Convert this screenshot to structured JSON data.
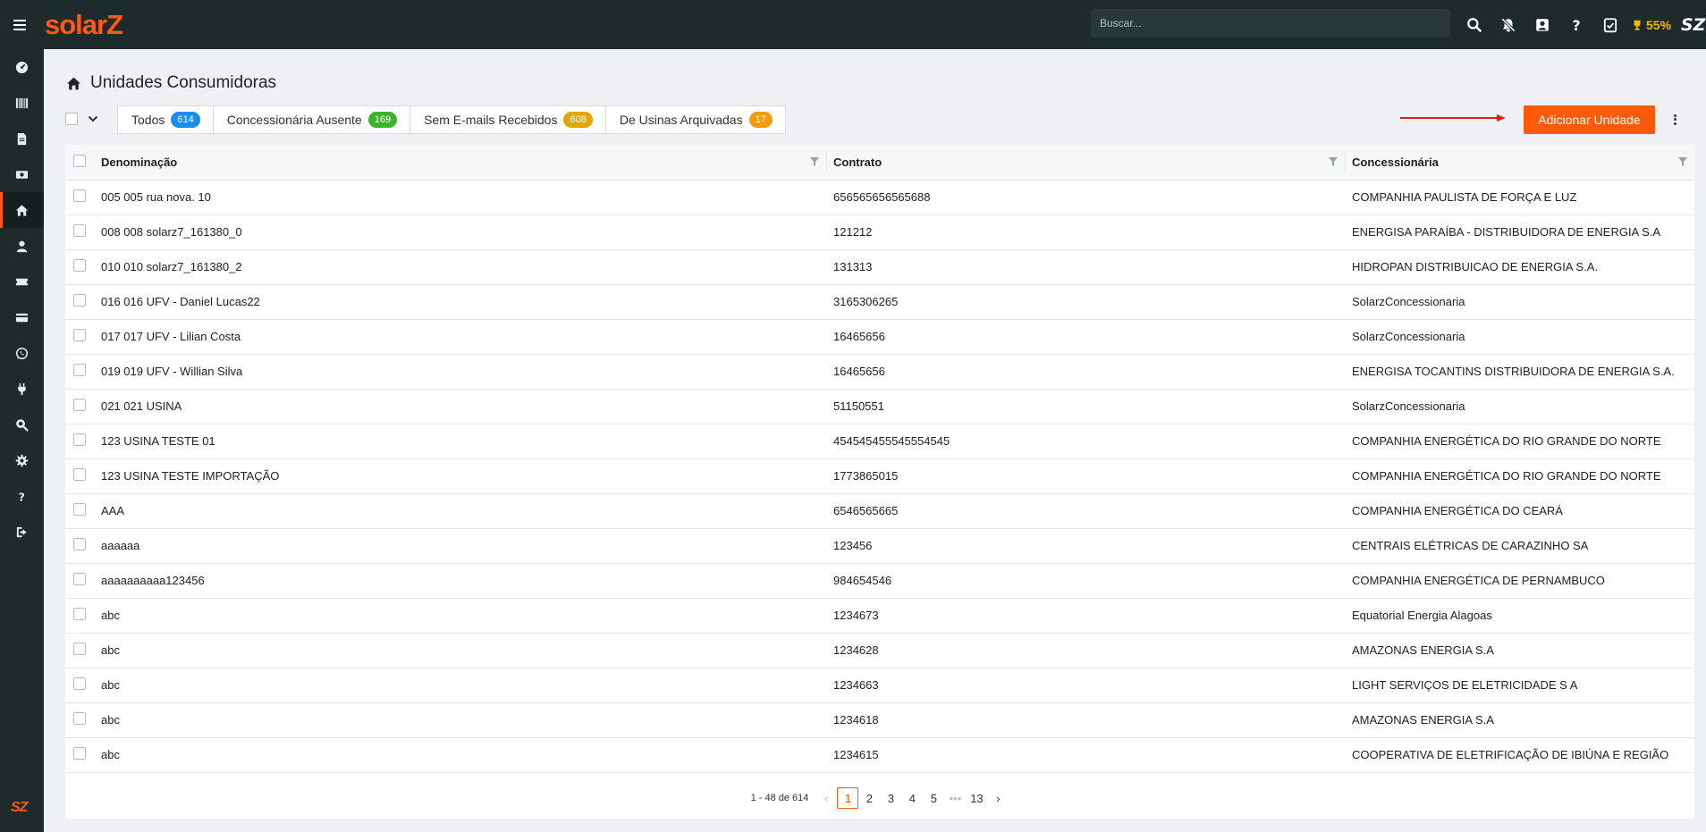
{
  "app": {
    "brand": "solarZ",
    "brand_color": "#ff5a12"
  },
  "topbar": {
    "search_placeholder": "Buscar...",
    "icons": [
      "search-icon",
      "notifications-off-icon",
      "user-badge-icon",
      "help-icon",
      "checklist-icon"
    ],
    "progress_label": "55%",
    "progress_percent": 55
  },
  "sidebar": {
    "items": [
      "dashboard-icon",
      "barcode-icon",
      "document-icon",
      "money-icon",
      "home-icon",
      "user-icon",
      "ticket-icon",
      "credit-card-icon",
      "whatsapp-icon",
      "plug-icon",
      "search-zoom-icon",
      "settings-icon",
      "help-icon",
      "logout-icon"
    ],
    "active_index": 4,
    "footer_logo": "SZ"
  },
  "page": {
    "title": "Unidades Consumidoras"
  },
  "tabs": [
    {
      "label": "Todos",
      "count": "614",
      "color": "#1a8ef0"
    },
    {
      "label": "Concessionária Ausente",
      "count": "169",
      "color": "#3bb32a"
    },
    {
      "label": "Sem E-mails Recebidos",
      "count": "608",
      "color": "#e0a800"
    },
    {
      "label": "De Usinas Arquivadas",
      "count": "17",
      "color": "#f59a0a"
    }
  ],
  "actions": {
    "add_label": "Adicionar Unidade"
  },
  "table": {
    "columns": [
      "Denominação",
      "Contrato",
      "Concessionária"
    ],
    "rows": [
      [
        "005 005 rua nova. 10",
        "656565656565688",
        "COMPANHIA PAULISTA DE FORÇA E LUZ"
      ],
      [
        "008 008 solarz7_161380_0",
        "121212",
        "ENERGISA PARAÍBA - DISTRIBUIDORA DE ENERGIA S.A"
      ],
      [
        "010 010 solarz7_161380_2",
        "131313",
        "HIDROPAN DISTRIBUICAO DE ENERGIA S.A."
      ],
      [
        "016 016 UFV - Daniel Lucas22",
        "3165306265",
        "SolarzConcessionaria"
      ],
      [
        "017 017 UFV - Lilian Costa",
        "16465656",
        "SolarzConcessionaria"
      ],
      [
        "019 019 UFV - Willian Silva",
        "16465656",
        "ENERGISA TOCANTINS DISTRIBUIDORA DE ENERGIA S.A."
      ],
      [
        "021 021 USINA",
        "51150551",
        "SolarzConcessionaria"
      ],
      [
        "123 USINA TESTE 01",
        "454545455545554545",
        "COMPANHIA ENERGÉTICA DO RIO GRANDE DO NORTE"
      ],
      [
        "123 USINA TESTE IMPORTAÇÃO",
        "1773865015",
        "COMPANHIA ENERGÉTICA DO RIO GRANDE DO NORTE"
      ],
      [
        "AAA",
        "6546565665",
        "COMPANHIA ENERGÉTICA DO CEARÁ"
      ],
      [
        "aaaaaa",
        "123456",
        "CENTRAIS ELÉTRICAS DE CARAZINHO SA"
      ],
      [
        "aaaaaaaaaa123456",
        "984654546",
        "COMPANHIA ENERGÉTICA DE PERNAMBUCO"
      ],
      [
        "abc",
        "1234673",
        "Equatorial Energia Alagoas"
      ],
      [
        "abc",
        "1234628",
        "AMAZONAS ENERGIA S.A"
      ],
      [
        "abc",
        "1234663",
        "LIGHT SERVIÇOS DE ELETRICIDADE S A"
      ],
      [
        "abc",
        "1234618",
        "AMAZONAS ENERGIA S.A"
      ],
      [
        "abc",
        "1234615",
        "COOPERATIVA DE ELETRIFICAÇÃO DE IBIÚNA E REGIÃO"
      ]
    ]
  },
  "pagination": {
    "range": "1 - 48 de 614",
    "pages": [
      "1",
      "2",
      "3",
      "4",
      "5",
      "•••",
      "13"
    ],
    "current": "1"
  }
}
